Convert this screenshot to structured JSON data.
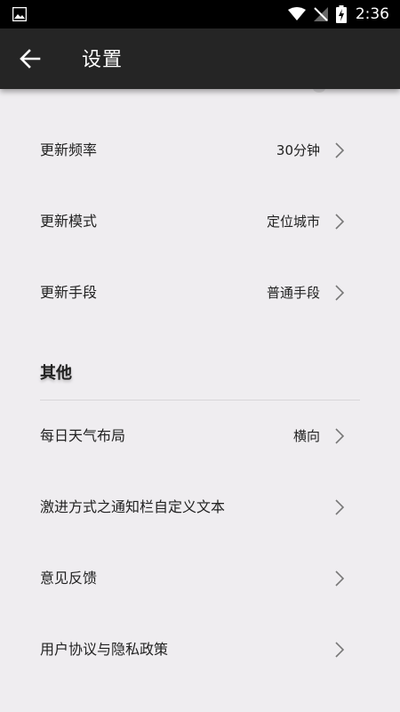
{
  "status_bar": {
    "time": "2:36"
  },
  "header": {
    "title": "设置"
  },
  "rows_top": [
    {
      "label": "更新频率",
      "value": "30分钟"
    },
    {
      "label": "更新模式",
      "value": "定位城市"
    },
    {
      "label": "更新手段",
      "value": "普通手段"
    }
  ],
  "section": {
    "title": "其他"
  },
  "rows_other": [
    {
      "label": "每日天气布局",
      "value": "横向"
    },
    {
      "label": "激进方式之通知栏自定义文本",
      "value": ""
    },
    {
      "label": "意见反馈",
      "value": ""
    },
    {
      "label": "用户协议与隐私政策",
      "value": ""
    }
  ]
}
